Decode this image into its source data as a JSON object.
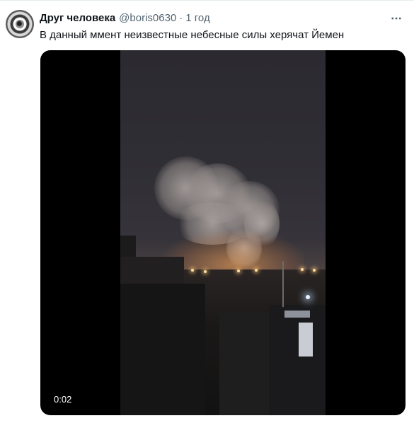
{
  "tweet": {
    "author_name": "Друг человека",
    "handle": "@boris0630",
    "separator": "·",
    "time": "1 год",
    "text": "В данный ммент неизвестные небесные силы херячат Йемен"
  },
  "media": {
    "type": "video",
    "duration": "0:02"
  },
  "icons": {
    "more": "more-horizontal-icon"
  },
  "colors": {
    "text_primary": "#0f1419",
    "text_secondary": "#536471",
    "media_background": "#000000"
  }
}
